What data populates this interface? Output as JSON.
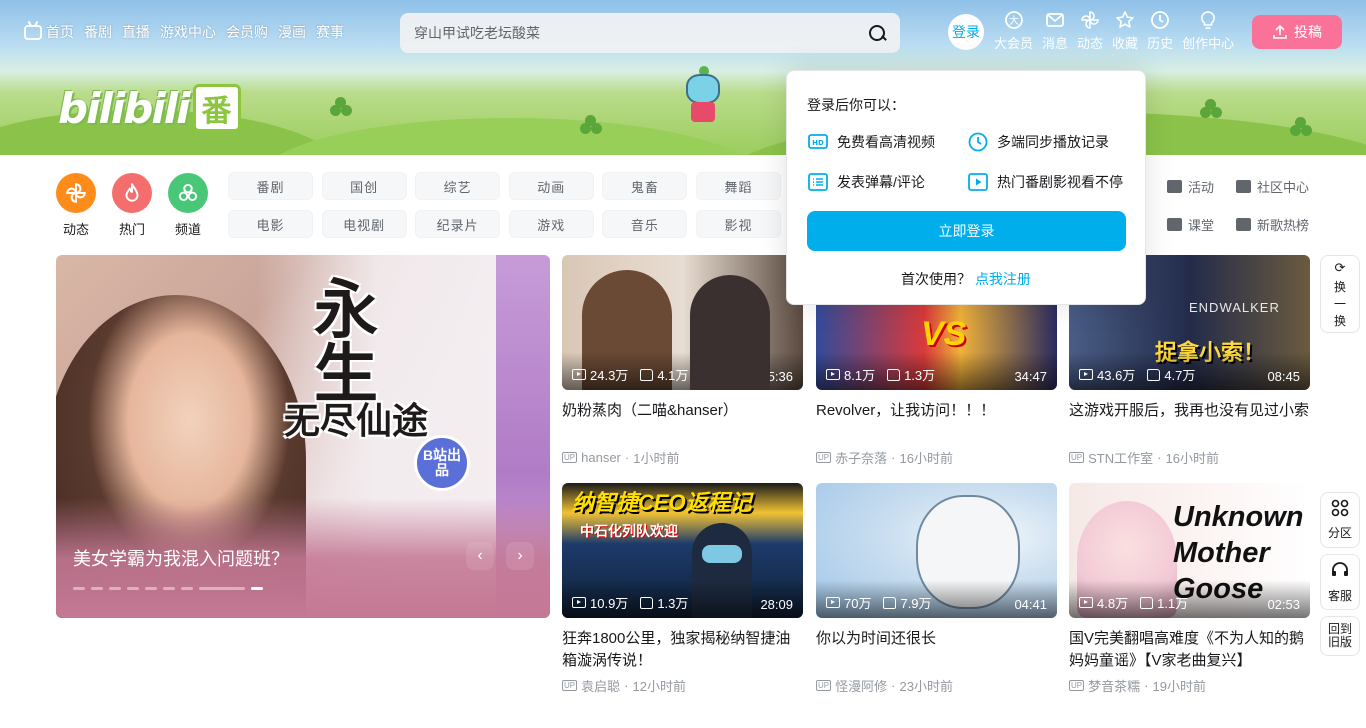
{
  "nav": {
    "left": [
      "首页",
      "番剧",
      "直播",
      "游戏中心",
      "会员购",
      "漫画",
      "赛事"
    ],
    "search_placeholder": "穿山甲试吃老坛酸菜",
    "login_avatar": "登录",
    "right": [
      "大会员",
      "消息",
      "动态",
      "收藏",
      "历史",
      "创作中心"
    ],
    "upload": "投稿"
  },
  "banner": {
    "logo_word": "bilibili",
    "logo_badge": "番"
  },
  "quick_channels": [
    {
      "label": "动态",
      "color": "#ff8c1a"
    },
    {
      "label": "热门",
      "color": "#f56e6e"
    },
    {
      "label": "频道",
      "color": "#48c778"
    }
  ],
  "chips": [
    "番剧",
    "国创",
    "综艺",
    "动画",
    "鬼畜",
    "舞蹈",
    "电影",
    "电视剧",
    "纪录片",
    "游戏",
    "音乐",
    "影视"
  ],
  "side_links": [
    "活动",
    "社区中心",
    "课堂",
    "新歌热榜"
  ],
  "carousel": {
    "caption": "美女学霸为我混入问题班？",
    "art_title": [
      "永",
      "生",
      "无尽仙途"
    ],
    "badge": "B站出品",
    "prev": "‹",
    "next": "›"
  },
  "videos": [
    {
      "title": "奶粉蒸肉（二喵&hanser）",
      "views": "24.3万",
      "likes": "4.1万",
      "duration": "15:36",
      "author": "hanser",
      "time": "1小时前"
    },
    {
      "title": "Revolver，让我访问！！！",
      "views": "8.1万",
      "likes": "1.3万",
      "duration": "34:47",
      "author": "赤子奈落",
      "time": "16小时前"
    },
    {
      "title": "这游戏开服后，我再也没有见过小索",
      "views": "43.6万",
      "likes": "4.7万",
      "duration": "08:45",
      "author": "STN工作室",
      "time": "16小时前",
      "art_top": "ENDWALKER",
      "art_big": "捉拿小索！"
    },
    {
      "title": "狂奔1800公里，独家揭秘纳智捷油箱漩涡传说！",
      "views": "10.9万",
      "likes": "1.3万",
      "duration": "28:09",
      "author": "袁启聪",
      "time": "12小时前",
      "art_big": "纳智捷CEO返程记",
      "art_sub": "中石化列队欢迎"
    },
    {
      "title": "你以为时间还很长",
      "views": "70万",
      "likes": "7.9万",
      "duration": "04:41",
      "author": "怪漫阿修",
      "time": "23小时前"
    },
    {
      "title": "国V完美翻唱高难度《不为人知的鹅妈妈童谣》【V家老曲复兴】",
      "views": "4.8万",
      "likes": "1.1万",
      "duration": "02:53",
      "author": "梦音茶糯",
      "time": "19小时前",
      "art_text": "Unknown Mother Goose"
    }
  ],
  "popup": {
    "title": "登录后你可以：",
    "benefits": [
      "免费看高清视频",
      "多端同步播放记录",
      "发表弹幕/评论",
      "热门番剧影视看不停"
    ],
    "login_button": "立即登录",
    "register_prompt": "首次使用？",
    "register_link": "点我注册"
  },
  "floating": {
    "refresh": [
      "换",
      "一",
      "换"
    ],
    "partition": "分区",
    "service": "客服",
    "old_version": [
      "回到",
      "旧版"
    ]
  },
  "colors": {
    "accent": "#00aeec",
    "pink": "#fb7299"
  }
}
